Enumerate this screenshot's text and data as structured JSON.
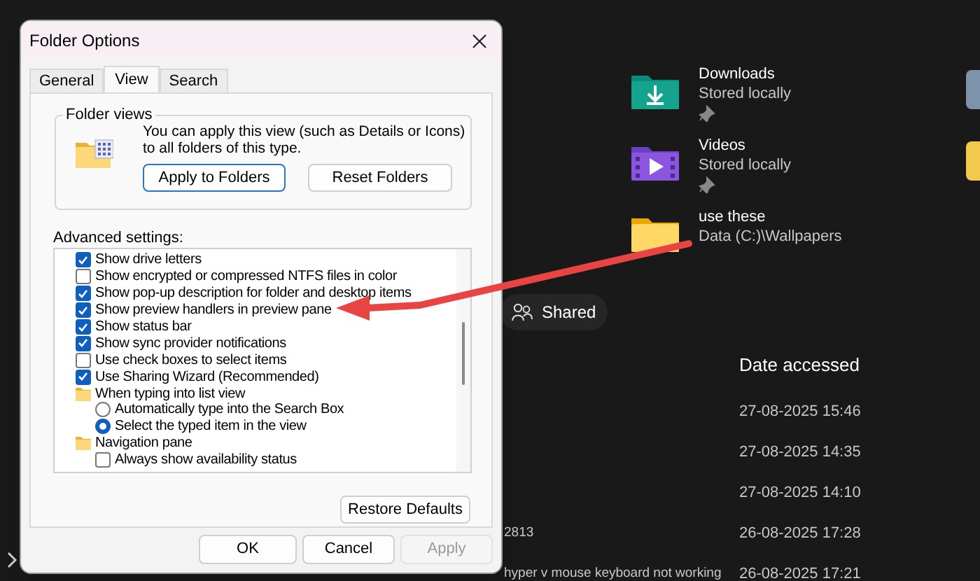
{
  "explorer": {
    "quick_access": [
      {
        "name": "Downloads",
        "location": "Stored locally",
        "pinned": true,
        "kind": "downloads"
      },
      {
        "name": "Videos",
        "location": "Stored locally",
        "pinned": true,
        "kind": "videos"
      },
      {
        "name": "use these",
        "location": "Data (C:)\\Wallpapers",
        "pinned": false,
        "kind": "folder"
      }
    ],
    "filter_chip": "Shared",
    "columns": [
      "Date accessed"
    ],
    "rows": [
      {
        "date": "27-08-2025 15:46"
      },
      {
        "date": "27-08-2025 14:35"
      },
      {
        "date": "27-08-2025 14:10"
      },
      {
        "name": "2813",
        "date": "26-08-2025 17:28"
      },
      {
        "name": "hyper v mouse keyboard not working",
        "date": "26-08-2025 17:21"
      }
    ]
  },
  "dialog": {
    "title": "Folder Options",
    "tabs": [
      {
        "label": "General",
        "selected": false
      },
      {
        "label": "View",
        "selected": true
      },
      {
        "label": "Search",
        "selected": false
      }
    ],
    "folder_views": {
      "legend": "Folder views",
      "description": "You can apply this view (such as Details or Icons) to all folders of this type.",
      "buttons": [
        "Apply to Folders",
        "Reset Folders"
      ]
    },
    "advanced_label": "Advanced settings:",
    "settings": [
      {
        "kind": "checkbox",
        "label": "Show drive letters",
        "checked": true
      },
      {
        "kind": "checkbox",
        "label": "Show encrypted or compressed NTFS files in color",
        "checked": false
      },
      {
        "kind": "checkbox",
        "label": "Show pop-up description for folder and desktop items",
        "checked": true
      },
      {
        "kind": "checkbox",
        "label": "Show preview handlers in preview pane",
        "checked": true
      },
      {
        "kind": "checkbox",
        "label": "Show status bar",
        "checked": true
      },
      {
        "kind": "checkbox",
        "label": "Show sync provider notifications",
        "checked": true
      },
      {
        "kind": "checkbox",
        "label": "Use check boxes to select items",
        "checked": false
      },
      {
        "kind": "checkbox",
        "label": "Use Sharing Wizard (Recommended)",
        "checked": true
      },
      {
        "kind": "group",
        "label": "When typing into list view",
        "children": [
          {
            "kind": "radio",
            "label": "Automatically type into the Search Box",
            "checked": false
          },
          {
            "kind": "radio",
            "label": "Select the typed item in the view",
            "checked": true
          }
        ]
      },
      {
        "kind": "group",
        "label": "Navigation pane",
        "children": [
          {
            "kind": "checkbox",
            "label": "Always show availability status",
            "checked": false
          }
        ]
      }
    ],
    "restore_button": "Restore Defaults",
    "buttons": [
      {
        "label": "OK",
        "disabled": false
      },
      {
        "label": "Cancel",
        "disabled": false
      },
      {
        "label": "Apply",
        "disabled": true
      }
    ]
  }
}
